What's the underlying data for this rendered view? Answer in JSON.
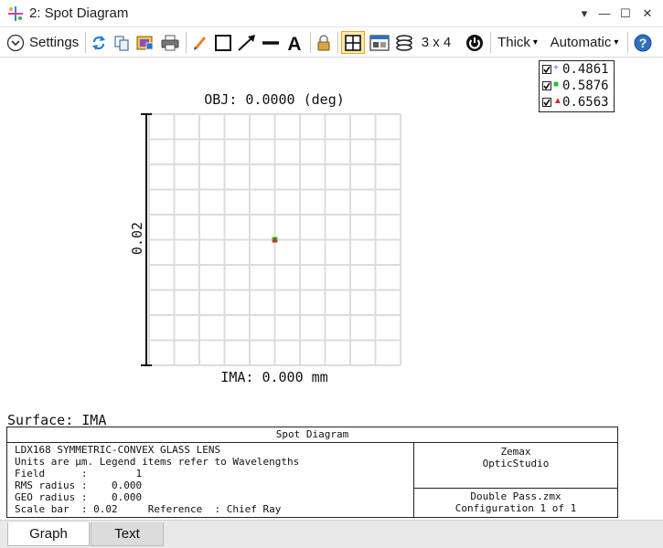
{
  "window": {
    "title": "2: Spot Diagram"
  },
  "window_controls": {
    "menu": "▾",
    "minimize": "—",
    "maximize": "☐",
    "close": "✕"
  },
  "toolbar": {
    "settings_label": "Settings",
    "grid_label": "3 x 4",
    "thickness_label": "Thick",
    "color_label": "Automatic",
    "dropdown_arrow": "▾"
  },
  "legend": {
    "items": [
      {
        "value": "0.4861",
        "marker": "+",
        "color": "#3b5bdb"
      },
      {
        "value": "0.5876",
        "marker": "■",
        "color": "#22c32e"
      },
      {
        "value": "0.6563",
        "marker": "▲",
        "color": "#d62828"
      }
    ]
  },
  "plot": {
    "title": "OBJ: 0.0000 (deg)",
    "footer": "IMA: 0.000 mm",
    "scale_label": "0.02",
    "grid_divisions": 10,
    "spot_color": "#d62828",
    "spot_secondary_color": "#22c32e"
  },
  "surface_label": "Surface: IMA",
  "info": {
    "title": "Spot Diagram",
    "lines": [
      "LDX168 SYMMETRIC-CONVEX GLASS LENS",
      "Units are µm. Legend items refer to Wavelengths",
      "Field      :        1",
      "RMS radius :    0.000",
      "GEO radius :    0.000",
      "Scale bar  : 0.02     Reference  : Chief Ray"
    ],
    "company_line1": "Zemax",
    "company_line2": "OpticStudio",
    "file_line": "Double Pass.zmx",
    "config_line": "Configuration 1 of 1"
  },
  "tabs": [
    {
      "label": "Graph"
    },
    {
      "label": "Text"
    }
  ]
}
